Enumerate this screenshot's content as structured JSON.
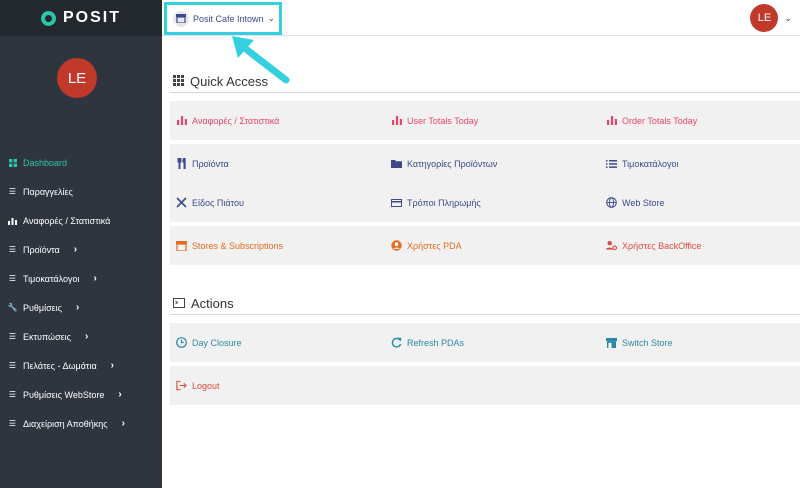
{
  "brand": {
    "logo_text": "POSIT",
    "logo_color": "#2ec4a8"
  },
  "user": {
    "initials": "LE",
    "avatar_color": "#c0392b"
  },
  "store_selector": {
    "label": "Posit Cafe Intown",
    "highlight_color": "#35d0e0"
  },
  "sidebar": {
    "items": [
      {
        "label": "Dashboard",
        "icon": "grid-icon",
        "active": true
      },
      {
        "label": "Παραγγελίες",
        "icon": "list-icon"
      },
      {
        "label": "Αναφορές / Στατιστικά",
        "icon": "bar-chart-icon"
      },
      {
        "label": "Προϊόντα",
        "icon": "list-icon",
        "has_submenu": true
      },
      {
        "label": "Τιμοκατάλογοι",
        "icon": "list-icon",
        "has_submenu": true
      },
      {
        "label": "Ρυθμίσεις",
        "icon": "wrench-icon",
        "has_submenu": true
      },
      {
        "label": "Εκτυπώσεις",
        "icon": "list-icon",
        "has_submenu": true
      },
      {
        "label": "Πελάτες - Δωμάτια",
        "icon": "list-icon",
        "has_submenu": true
      },
      {
        "label": "Ρυθμίσεις WebStore",
        "icon": "list-icon",
        "has_submenu": true
      },
      {
        "label": "Διαχείριση Αποθήκης",
        "icon": "list-icon",
        "has_submenu": true
      }
    ]
  },
  "quick_access": {
    "title": "Quick Access",
    "rows": [
      [
        {
          "label": "Αναφορές / Στατιστικά",
          "icon": "bar-chart-icon",
          "color": "#e8456a"
        },
        {
          "label": "User Totals Today",
          "icon": "bar-chart-icon",
          "color": "#e8456a"
        },
        {
          "label": "Order Totals Today",
          "icon": "bar-chart-icon",
          "color": "#e8456a"
        }
      ],
      [
        {
          "label": "Προϊόντα",
          "icon": "fork-knife-icon",
          "color": "#3a4a8c"
        },
        {
          "label": "Κατηγορίες Προϊόντων",
          "icon": "folder-icon",
          "color": "#3a4a8c"
        },
        {
          "label": "Τιμοκατάλογοι",
          "icon": "list-icon",
          "color": "#3a4a8c"
        }
      ],
      [
        {
          "label": "Είδος Πιάτου",
          "icon": "utensils-cross-icon",
          "color": "#3a4a8c"
        },
        {
          "label": "Τρόποι Πληρωμής",
          "icon": "credit-card-icon",
          "color": "#3a4a8c"
        },
        {
          "label": "Web Store",
          "icon": "globe-icon",
          "color": "#3a4a8c"
        }
      ],
      [
        {
          "label": "Stores & Subscriptions",
          "icon": "store-icon",
          "color": "#e56b1f"
        },
        {
          "label": "Χρήστες PDA",
          "icon": "user-circle-icon",
          "color": "#e56b1f"
        },
        {
          "label": "Χρήστες BackOffice",
          "icon": "user-gear-icon",
          "color": "#e14b3b"
        }
      ]
    ]
  },
  "actions": {
    "title": "Actions",
    "rows": [
      [
        {
          "label": "Day Closure",
          "icon": "clock-icon",
          "color": "#2a8aa6"
        },
        {
          "label": "Refresh PDAs",
          "icon": "refresh-icon",
          "color": "#2a8aa6"
        },
        {
          "label": "Switch Store",
          "icon": "store-icon",
          "color": "#2a8aa6"
        }
      ],
      [
        {
          "label": "Logout",
          "icon": "logout-icon",
          "color": "#e14b3b"
        }
      ]
    ]
  }
}
